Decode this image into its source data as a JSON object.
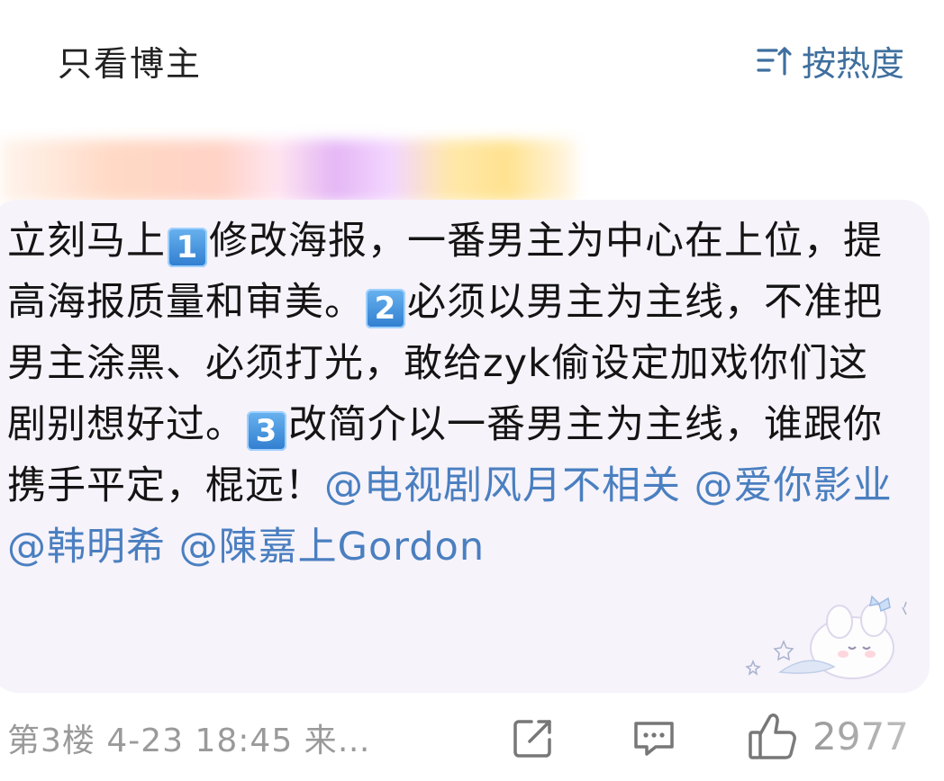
{
  "header": {
    "only_poster_label": "只看博主",
    "sort_label": "按热度"
  },
  "post": {
    "content": {
      "seg1": "立刻马上",
      "num1": "1",
      "seg2": "修改海报，一番男主为中心在上位，提高海报质量和审美。",
      "num2": "2",
      "seg3": "必须以男主为主线，不准把男主涂黑、必须打光，敢给zyk偷设定加戏你们这剧别想好过。",
      "num3": "3",
      "seg4": "改简介以一番男主为主线，谁跟你携手平定，棍远！",
      "mentions": [
        "@电视剧风月不相关",
        "@爱你影业",
        "@韩明希",
        "@陳嘉上Gordon"
      ]
    }
  },
  "footer": {
    "floor_info": "第3楼  4-23 18:45  来…",
    "like_count": "2977"
  },
  "colors": {
    "mention": "#4a7fc0",
    "sort": "#3f6f9e",
    "bubble_bg": "#f6f3fa",
    "meta": "#9a9a9a"
  },
  "icons": [
    "sort-icon",
    "share-icon",
    "comment-icon",
    "like-icon"
  ]
}
